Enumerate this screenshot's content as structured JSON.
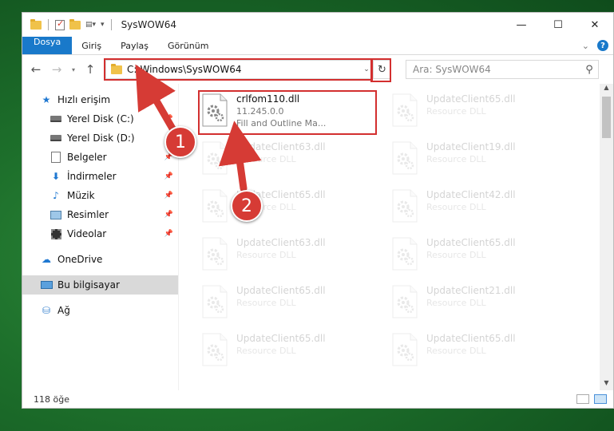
{
  "window": {
    "title": "SysWOW64"
  },
  "ribbon": {
    "tabs": [
      "Dosya",
      "Giriş",
      "Paylaş",
      "Görünüm"
    ]
  },
  "address": {
    "path": "C:\\Windows\\SysWOW64"
  },
  "search": {
    "placeholder": "Ara: SysWOW64"
  },
  "sidebar": {
    "items": [
      {
        "label": "Hızlı erişim",
        "icon": "star-icon"
      },
      {
        "label": "Yerel Disk (C:)",
        "icon": "drive-icon"
      },
      {
        "label": "Yerel Disk (D:)",
        "icon": "drive-icon"
      },
      {
        "label": "Belgeler",
        "icon": "documents-icon"
      },
      {
        "label": "İndirmeler",
        "icon": "download-icon"
      },
      {
        "label": "Müzik",
        "icon": "music-icon"
      },
      {
        "label": "Resimler",
        "icon": "pictures-icon"
      },
      {
        "label": "Videolar",
        "icon": "videos-icon"
      },
      {
        "label": "OneDrive",
        "icon": "cloud-icon"
      },
      {
        "label": "Bu bilgisayar",
        "icon": "computer-icon"
      },
      {
        "label": "Ağ",
        "icon": "network-icon"
      }
    ]
  },
  "files": [
    {
      "name": "crlfom110.dll",
      "version": "11.245.0.0",
      "desc": "Fill and Outline Ma..."
    },
    {
      "name": "UpdateClient65.dll",
      "desc": "Resource DLL"
    },
    {
      "name": "UpdateClient63.dll",
      "desc": "Resource DLL"
    },
    {
      "name": "UpdateClient19.dll",
      "desc": "Resource DLL"
    },
    {
      "name": "UpdateClient65.dll",
      "desc": "Resource DLL"
    },
    {
      "name": "UpdateClient42.dll",
      "desc": "Resource DLL"
    },
    {
      "name": "UpdateClient63.dll",
      "desc": "Resource DLL"
    },
    {
      "name": "UpdateClient65.dll",
      "desc": "Resource DLL"
    },
    {
      "name": "UpdateClient65.dll",
      "desc": "Resource DLL"
    },
    {
      "name": "UpdateClient21.dll",
      "desc": "Resource DLL"
    },
    {
      "name": "UpdateClient65.dll",
      "desc": "Resource DLL"
    },
    {
      "name": "UpdateClient65.dll",
      "desc": "Resource DLL"
    }
  ],
  "status": {
    "count": "118 öğe"
  },
  "callouts": [
    "1",
    "2"
  ],
  "colors": {
    "accent": "#1979ca",
    "highlight": "#d32f2f",
    "badge": "#d63b35"
  }
}
